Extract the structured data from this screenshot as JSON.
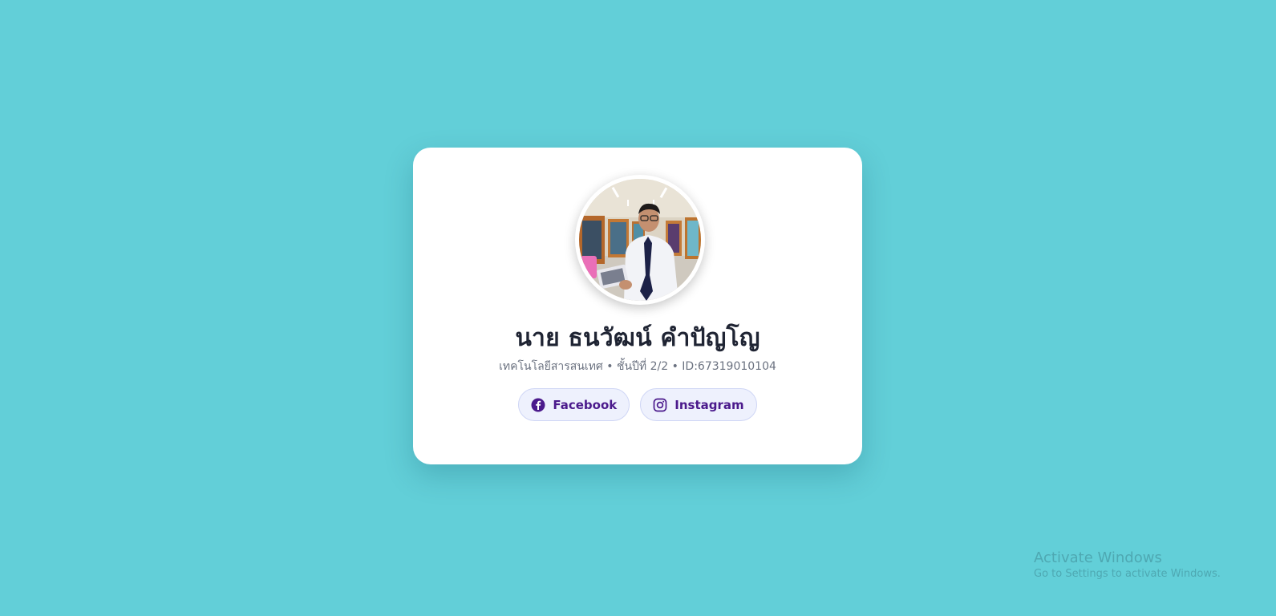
{
  "profile": {
    "name": "นาย ธนวัฒน์ คำปัญโญ",
    "meta": "เทคโนโลยีสารสนเทศ • ชั้นปีที่ 2/2 • ID:67319010104",
    "avatar_icon": "profile-photo"
  },
  "links": [
    {
      "label": "Facebook",
      "icon": "facebook-icon"
    },
    {
      "label": "Instagram",
      "icon": "instagram-icon"
    }
  ],
  "watermark": {
    "title": "Activate Windows",
    "subtitle": "Go to Settings to activate Windows."
  },
  "colors": {
    "background": "#62cfd8",
    "card": "#ffffff",
    "button_bg": "#eef1fd",
    "button_text": "#4b1a8c"
  }
}
